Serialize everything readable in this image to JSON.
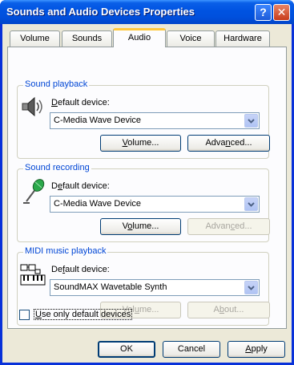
{
  "window": {
    "title": "Sounds and Audio Devices Properties"
  },
  "titlebar": {
    "help_glyph": "?",
    "close_glyph": "✕"
  },
  "tabs": [
    {
      "label": "Volume",
      "active": false
    },
    {
      "label": "Sounds",
      "active": false
    },
    {
      "label": "Audio",
      "active": true
    },
    {
      "label": "Voice",
      "active": false
    },
    {
      "label": "Hardware",
      "active": false
    }
  ],
  "playback": {
    "group_title": "Sound playback",
    "icon": "speaker-icon",
    "label_first": "D",
    "label_rest": "efault device:",
    "device": "C-Media Wave Device",
    "volume_first": "V",
    "volume_rest": "olume...",
    "advanced_pre": "Adva",
    "advanced_u": "n",
    "advanced_post": "ced..."
  },
  "recording": {
    "group_title": "Sound recording",
    "icon": "microphone-icon",
    "label_pre": "D",
    "label_u": "e",
    "label_post": "fault device:",
    "device": "C-Media Wave Device",
    "volume_pre": "V",
    "volume_u": "o",
    "volume_post": "lume...",
    "advanced_pre": "Advan",
    "advanced_u": "c",
    "advanced_post": "ed..."
  },
  "midi": {
    "group_title": "MIDI music playback",
    "icon": "midi-keyboard-icon",
    "label_pre": "De",
    "label_u": "f",
    "label_post": "ault device:",
    "device": "SoundMAX Wavetable Synth",
    "volume_pre": "Vol",
    "volume_u": "u",
    "volume_post": "me...",
    "about_pre": "A",
    "about_u": "b",
    "about_post": "out..."
  },
  "use_default": {
    "label_first": "U",
    "label_rest": "se only default devices",
    "checked": false
  },
  "buttons": {
    "ok": "OK",
    "cancel": "Cancel",
    "apply_first": "A",
    "apply_rest": "pply"
  }
}
